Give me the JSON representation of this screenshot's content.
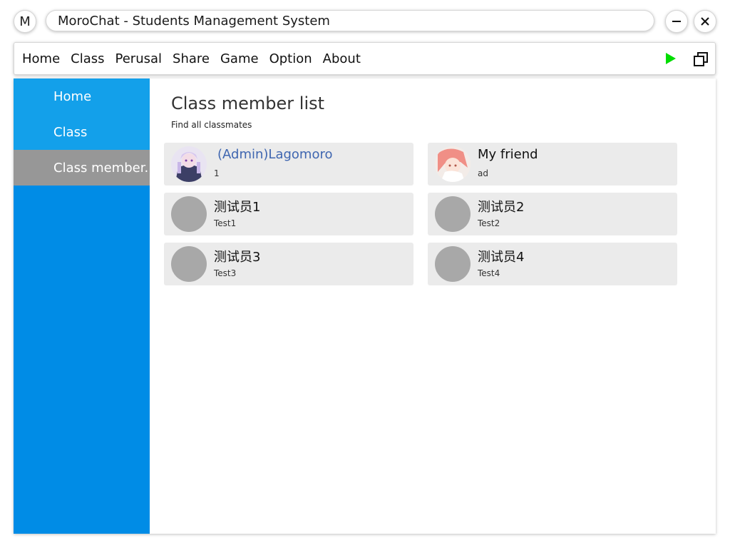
{
  "app": {
    "logo_letter": "M",
    "title": "MoroChat - Students Management System"
  },
  "menu": {
    "items": [
      "Home",
      "Class",
      "Perusal",
      "Share",
      "Game",
      "Option",
      "About"
    ],
    "run_icon": "play-icon",
    "window_icon": "restore-window-icon"
  },
  "sidebar": {
    "items": [
      {
        "label": "Home"
      },
      {
        "label": "Class"
      },
      {
        "label": "Class member..."
      }
    ]
  },
  "page": {
    "title": "Class member list",
    "subtitle": "Find all classmates"
  },
  "members": [
    {
      "name": "(Admin)Lagomoro",
      "sub": "1"
    },
    {
      "name": "My friend",
      "sub": "ad"
    },
    {
      "name": "测试员1",
      "sub": "Test1"
    },
    {
      "name": "测试员2",
      "sub": "Test2"
    },
    {
      "name": "测试员3",
      "sub": "Test3"
    },
    {
      "name": "测试员4",
      "sub": "Test4"
    }
  ],
  "colors": {
    "sidebar": "#008ce6",
    "sidebar_item": "#13a0ea",
    "sidebar_active": "#979797",
    "admin_name": "#3f66b0",
    "run_icon": "#00dd00",
    "card": "#ebebeb"
  }
}
